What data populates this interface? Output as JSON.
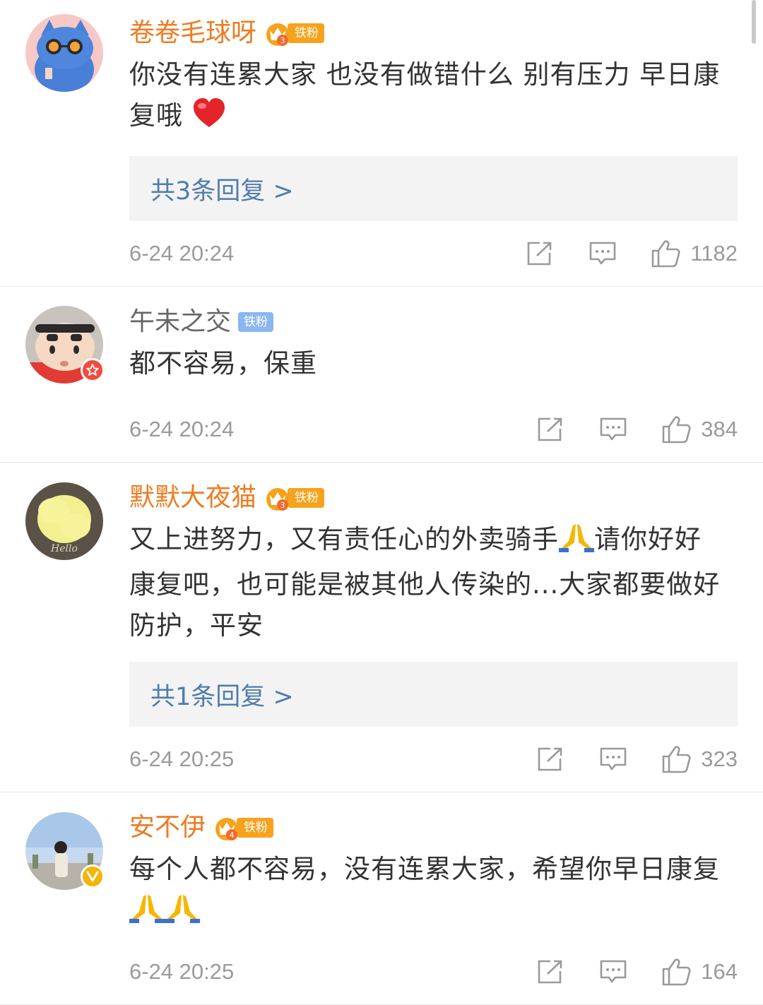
{
  "comments": [
    {
      "username": "卷卷毛球呀",
      "fan_badge": "铁粉",
      "fan_level": "3",
      "text": "你没有连累大家 也没有做错什么 别有压力 早日康复哦",
      "emoji": "heart",
      "replies": "共3条回复 >",
      "time": "6-24 20:24",
      "likes": "1182"
    },
    {
      "username": "午未之交",
      "fan_badge": "铁粉",
      "text": "都不容易，保重",
      "time": "6-24 20:24",
      "likes": "384"
    },
    {
      "username": "默默大夜猫",
      "fan_badge": "铁粉",
      "fan_level": "3",
      "text_a": "又上进努力，又有责任心的外卖骑手",
      "text_b": "请你好好康复吧，也可能是被其他人传染的...大家都要做好防护，平安",
      "emoji": "pray",
      "replies": "共1条回复 >",
      "time": "6-24 20:25",
      "likes": "323"
    },
    {
      "username": "安不伊",
      "fan_badge": "铁粉",
      "fan_level": "4",
      "text": "每个人都不容易，没有连累大家，希望你早日康复",
      "emoji": "pray",
      "time": "6-24 20:25",
      "likes": "164"
    }
  ],
  "icons": {
    "share": "share-icon",
    "comment": "comment-icon",
    "like": "thumbs-up-icon"
  },
  "colors": {
    "vip_name": "#ee7b21",
    "reply_link": "#4f7dad",
    "meta_text": "#9a9a9a",
    "fan_badge_gold": "#f7a21c",
    "fan_badge_blue": "#8ab6f1"
  }
}
